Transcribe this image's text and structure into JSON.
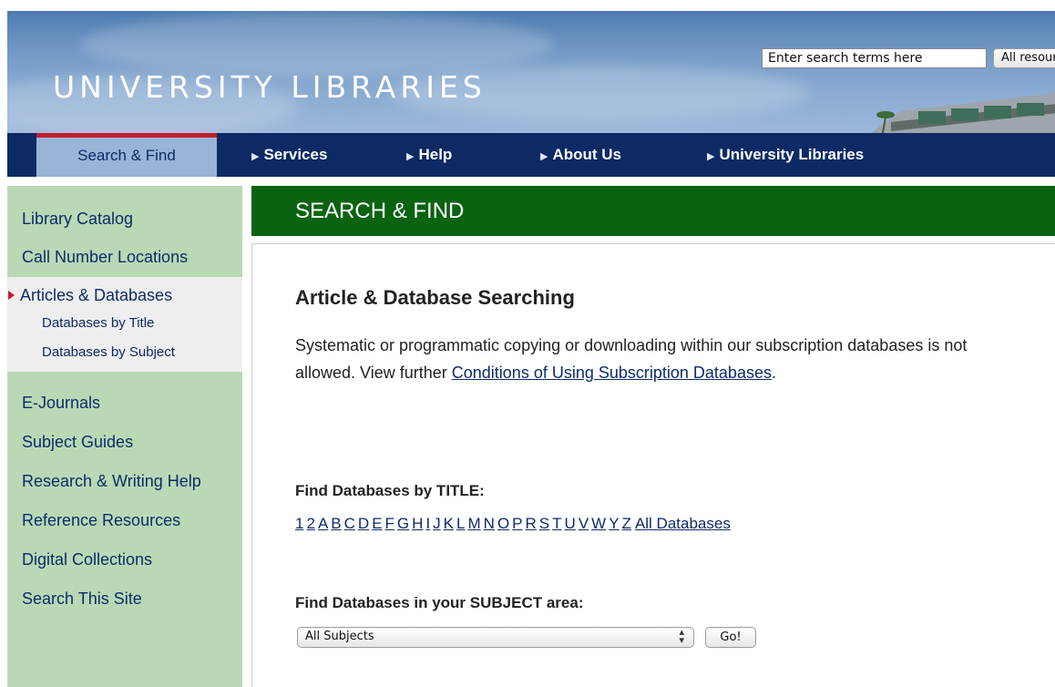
{
  "header": {
    "site_title": "UNIVERSITY LIBRARIES",
    "search_value": "Enter search terms here",
    "search_scope": "All resources"
  },
  "nav": {
    "active": "Search & Find",
    "items": [
      {
        "label": "Services"
      },
      {
        "label": "Help"
      },
      {
        "label": "About Us"
      },
      {
        "label": "University Libraries"
      }
    ]
  },
  "sidebar": {
    "items": [
      {
        "label": "Library Catalog"
      },
      {
        "label": "Call Number Locations"
      }
    ],
    "current": {
      "label": "Articles & Databases",
      "subitems": [
        {
          "label": "Databases by Title"
        },
        {
          "label": "Databases by Subject"
        }
      ]
    },
    "items_after": [
      {
        "label": "E-Journals"
      },
      {
        "label": "Subject Guides"
      },
      {
        "label": "Research & Writing Help"
      },
      {
        "label": "Reference Resources"
      },
      {
        "label": "Digital Collections"
      },
      {
        "label": "Search This Site"
      }
    ]
  },
  "main": {
    "banner_title": "SEARCH & FIND",
    "heading": "Article & Database Searching",
    "intro_text": "Systematic or programmatic copying or downloading within our subscription databases is not allowed. View further ",
    "intro_link": "Conditions of Using Subscription Databases",
    "intro_end": ".",
    "title_label": "Find Databases by TITLE:",
    "alpha_links": [
      "1",
      "2",
      "A",
      "B",
      "C",
      "D",
      "E",
      "F",
      "G",
      "H",
      "I",
      "J",
      "K",
      "L",
      "M",
      "N",
      "O",
      "P",
      "R",
      "S",
      "T",
      "U",
      "V",
      "W",
      "Y",
      "Z"
    ],
    "all_databases": "All Databases",
    "subject_label": "Find Databases in your SUBJECT area:",
    "subject_select": "All Subjects",
    "go_button": "Go!"
  },
  "colors": {
    "nav_bg": "#0d2a65",
    "nav_active_bg": "#98b4d6",
    "accent_red": "#c41e2e",
    "sidebar_bg": "#b9d9b5",
    "banner_green": "#0a6311",
    "link": "#0e2b6a"
  }
}
